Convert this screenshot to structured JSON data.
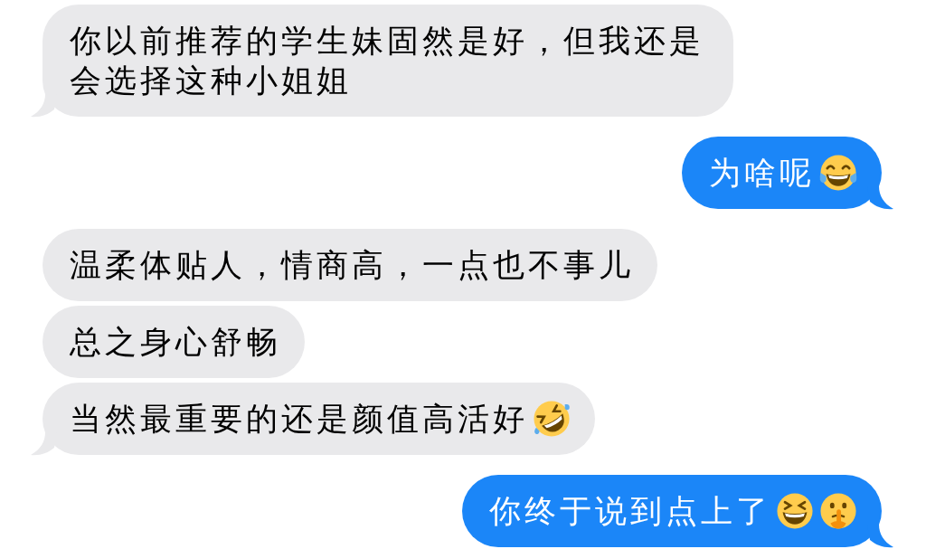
{
  "messages": [
    {
      "outgoing": false,
      "tail": true,
      "text": "你以前推荐的学生妹固然是好，但我还是会选择这种小姐姐"
    },
    {
      "outgoing": true,
      "tail": true,
      "text": "为啥呢",
      "emojis": [
        {
          "kind": "tears-of-joy"
        }
      ]
    },
    {
      "outgoing": false,
      "tail": false,
      "text": "温柔体贴人，情商高，一点也不事儿"
    },
    {
      "outgoing": false,
      "tail": false,
      "text": "总之身心舒畅"
    },
    {
      "outgoing": false,
      "tail": true,
      "text": "当然最重要的还是颜值高活好",
      "emojis": [
        {
          "kind": "rolling-laughing"
        }
      ]
    },
    {
      "outgoing": true,
      "tail": true,
      "text": "你终于说到点上了",
      "emojis": [
        {
          "kind": "squinting-grin"
        },
        {
          "kind": "shushing"
        }
      ]
    }
  ]
}
